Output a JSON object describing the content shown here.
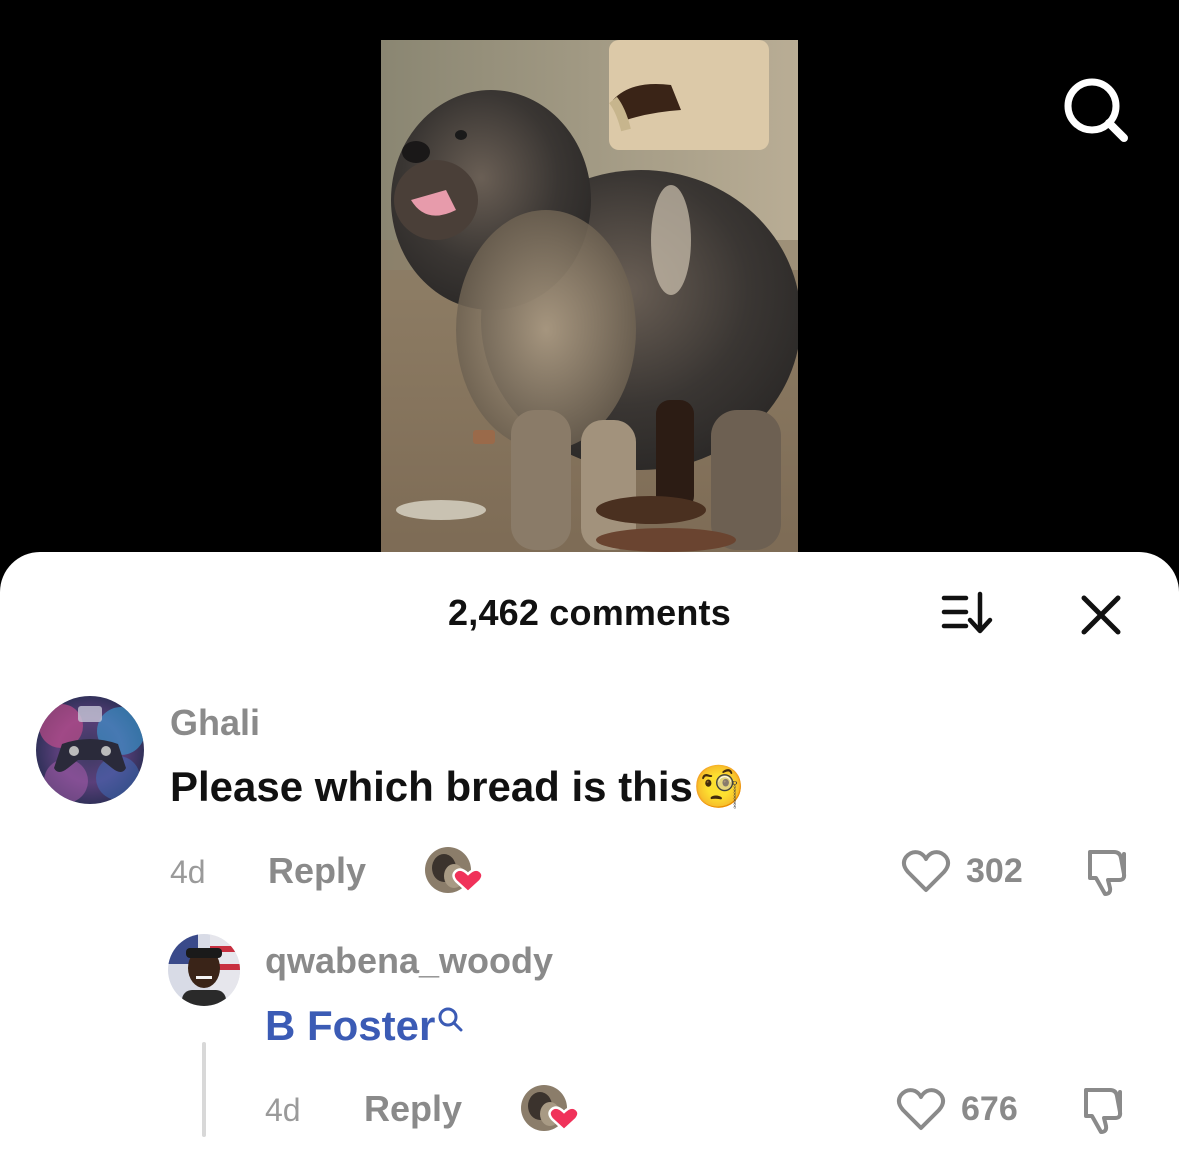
{
  "video": {
    "search_icon": "search-icon"
  },
  "sheet": {
    "title": "2,462 comments",
    "sort_icon": "sort-icon",
    "close_icon": "close-icon"
  },
  "comments": [
    {
      "username": "Ghali",
      "text": "Please which bread is this",
      "emoji": "🧐",
      "time": "4d",
      "reply_label": "Reply",
      "likes": "302"
    },
    {
      "username": "qwabena_woody",
      "link_text": "B Foster",
      "link_icon": "search-icon",
      "time": "4d",
      "reply_label": "Reply",
      "likes": "676"
    }
  ],
  "colors": {
    "sheet_bg": "#ffffff",
    "link": "#3b5bb5",
    "heart_badge": "#f0325a",
    "muted": "#8a8a8a"
  }
}
